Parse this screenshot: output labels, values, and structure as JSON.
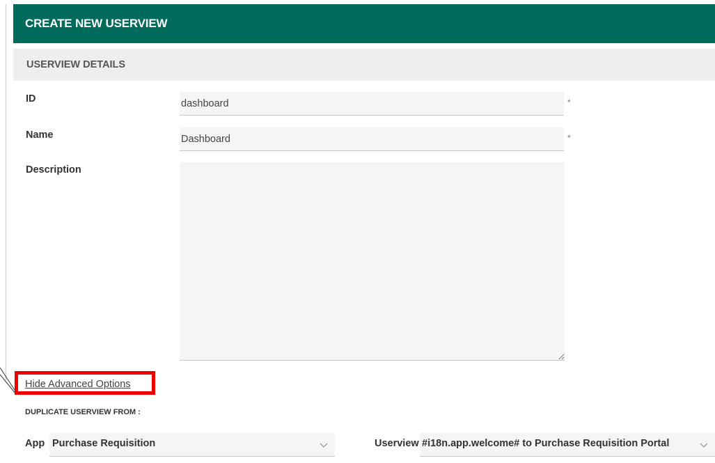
{
  "header": {
    "title": "CREATE NEW USERVIEW"
  },
  "section": {
    "title": "USERVIEW DETAILS"
  },
  "fields": {
    "id": {
      "label": "ID",
      "value": "dashboard",
      "required": "*"
    },
    "name": {
      "label": "Name",
      "value": "Dashboard",
      "required": "*"
    },
    "description": {
      "label": "Description",
      "value": ""
    }
  },
  "advanced": {
    "link_label": "Hide Advanced Options"
  },
  "duplicate": {
    "heading": "DUPLICATE USERVIEW FROM :",
    "app": {
      "label": "App",
      "selected": "Purchase Requisition"
    },
    "userview": {
      "label": "Userview",
      "selected": "#i18n.app.welcome# to Purchase Requisition Portal"
    }
  },
  "colors": {
    "header_bg": "#006b5b",
    "section_bg": "#eceeef",
    "highlight": "#ee0000"
  },
  "icons": [
    "chevron-down-icon",
    "resize-grip-icon"
  ]
}
